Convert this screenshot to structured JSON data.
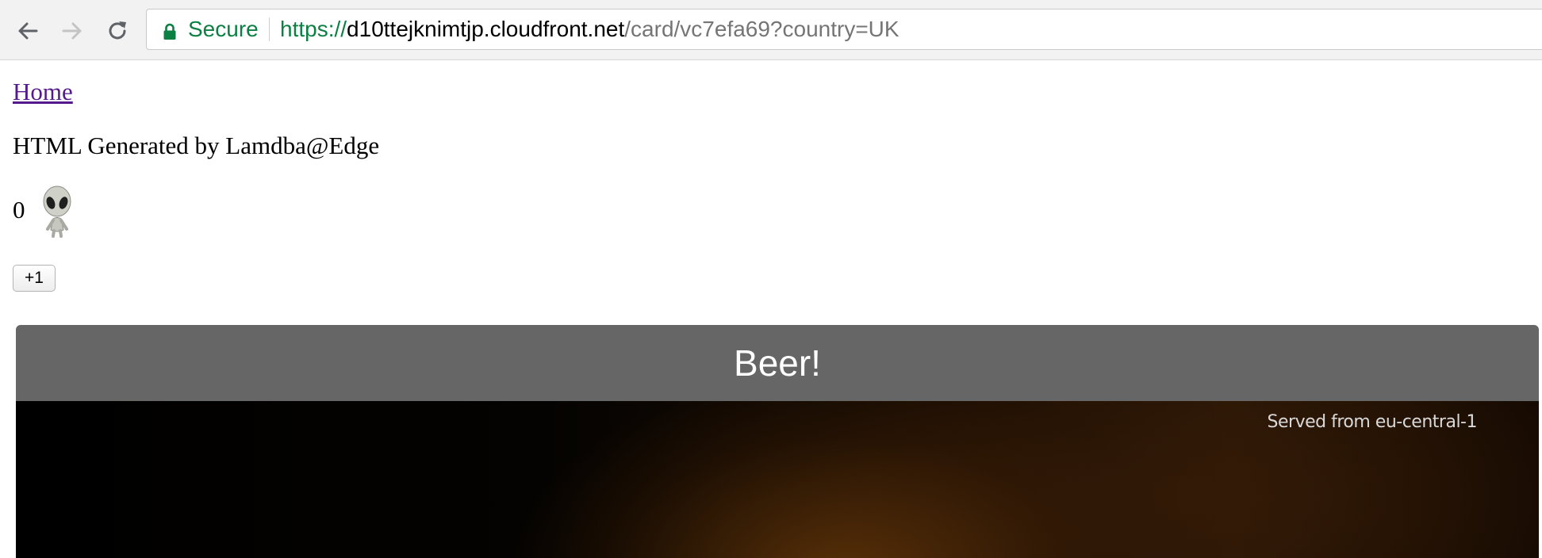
{
  "browser": {
    "secure_label": "Secure",
    "url_scheme": "https://",
    "url_host": "d10ttejknimtjp.cloudfront.net",
    "url_path": "/card/vc7efa69?country=UK",
    "back_icon": "back-arrow-icon",
    "forward_icon": "forward-arrow-icon",
    "reload_icon": "reload-icon",
    "lock_icon": "lock-icon",
    "secure_color": "#0b8043"
  },
  "page": {
    "home_link": "Home",
    "heading": "HTML Generated by Lamdba@Edge",
    "count": "0",
    "count_icon": "alien-icon",
    "plus_button": "+1",
    "link_color": "#551a8b"
  },
  "card": {
    "title": "Beer!",
    "served_from": "Served from eu-central-1",
    "header_color": "#666666"
  }
}
